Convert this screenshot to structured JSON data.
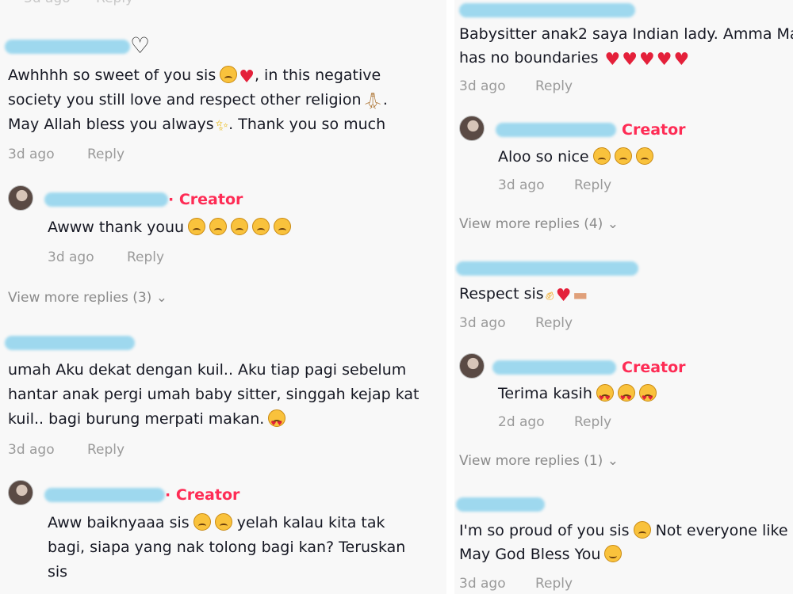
{
  "common": {
    "reply": "Reply",
    "creator": "Creator"
  },
  "left": {
    "c1": {
      "lines": [
        "Awhhhh so sweet of you sis",
        ", in this negative",
        "society you still love and respect other religion",
        ".",
        "May Allah bless you always",
        ". Thank you so much"
      ],
      "time": "3d ago"
    },
    "r1": {
      "text": "Awww thank youu",
      "time": "3d ago"
    },
    "vm1": "View more replies (3)",
    "c2": {
      "lines": [
        "umah Aku dekat dengan kuil.. Aku tiap pagi sebelum",
        "hantar anak pergi umah baby sitter, singgah kejap kat",
        "kuil.. bagi burung merpati makan."
      ],
      "time": "3d ago"
    },
    "r2": {
      "lines": [
        "Aww baiknyaaa sis",
        "yelah kalau kita tak",
        "bagi, siapa yang nak tolong bagi kan? Teruskan",
        "sis"
      ]
    }
  },
  "right": {
    "c1": {
      "lines": [
        "Babysitter anak2 saya Indian lady. Amma Ma",
        "has no boundaries"
      ],
      "time": "3d ago"
    },
    "r1": {
      "text": "Aloo so nice",
      "time": "3d ago"
    },
    "vm1": "View more replies (4)",
    "c2": {
      "text": "Respect sis",
      "time": "3d ago"
    },
    "r2": {
      "text": "Terima kasih",
      "time": "2d ago"
    },
    "vm2": "View more replies (1)",
    "c3": {
      "lines": [
        "I'm so proud of you sis",
        "Not everyone like",
        "May God Bless You"
      ],
      "time": "3d ago"
    }
  }
}
